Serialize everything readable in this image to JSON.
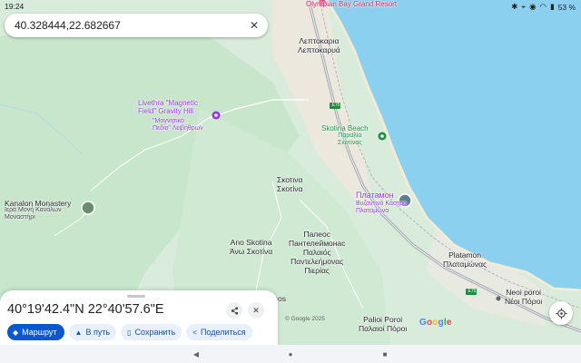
{
  "status_bar": {
    "time": "19:24",
    "battery": "53 %"
  },
  "search": {
    "query": "40.328444,22.682667",
    "clear_icon": "close-icon"
  },
  "map_labels": {
    "resort": "Olympian Bay\nGrand Resort",
    "leptokaria": "Λεπτοκαρια\nΛεπτοκαρυά",
    "livethra": "Livethra \"Magnetic\nField\" Gravity Hill",
    "livethra_gr": "\"Μαγνητικό\nΠεδίο\" Λειβήθρων",
    "e75_top": "E75",
    "skotina_beach": "Skotina Beach",
    "skotina_beach_gr": "Παραλία\nΣκοτίνας",
    "skotina": "Σκοτινα\nΣκοτίνα",
    "kanalon": "Kanalon Monastery",
    "kanalon_gr": "Ιερά Μονή Κανάλων\nΜοναστήρι",
    "platamon": "Платамон",
    "platamon_castle": "Βυζαντινό Κάστρο\nΠλαταμώνα",
    "ano_skotina": "Ano Skotina\nΆνω Σκοτίνα",
    "paleos": "Палеос\nПантелеймонас\nΠαλαιός\nΠαντελεήμονας\nΠιερίας",
    "platamon_town": "Platamon\nΠλαταμώνας",
    "e75_bottom": "E75",
    "neoi_poroi": "Neoi poroi\nΝέοι Πόροι",
    "palioi_poroi": "Palioi Poroi\nΠαλαιοί Πόροι",
    "pasos": "asos"
  },
  "bottom_sheet": {
    "title": "40°19'42.4\"N 22°40'57.6\"E",
    "actions": [
      {
        "label": "Маршрут",
        "icon": "directions-icon"
      },
      {
        "label": "В путь",
        "icon": "navigation-arrow-icon"
      },
      {
        "label": "Сохранить",
        "icon": "bookmark-icon"
      },
      {
        "label": "Поделиться",
        "icon": "share-icon"
      }
    ]
  },
  "map_footer": {
    "copyright": "© Google 2025",
    "logo": [
      "G",
      "o",
      "o",
      "g",
      "l",
      "e"
    ]
  },
  "colors": {
    "water": "#8cd0f0",
    "land": "#dfeee0",
    "primary": "#0b57d0",
    "chip_bg": "#e8f0fe",
    "poi": "#9334e6"
  }
}
